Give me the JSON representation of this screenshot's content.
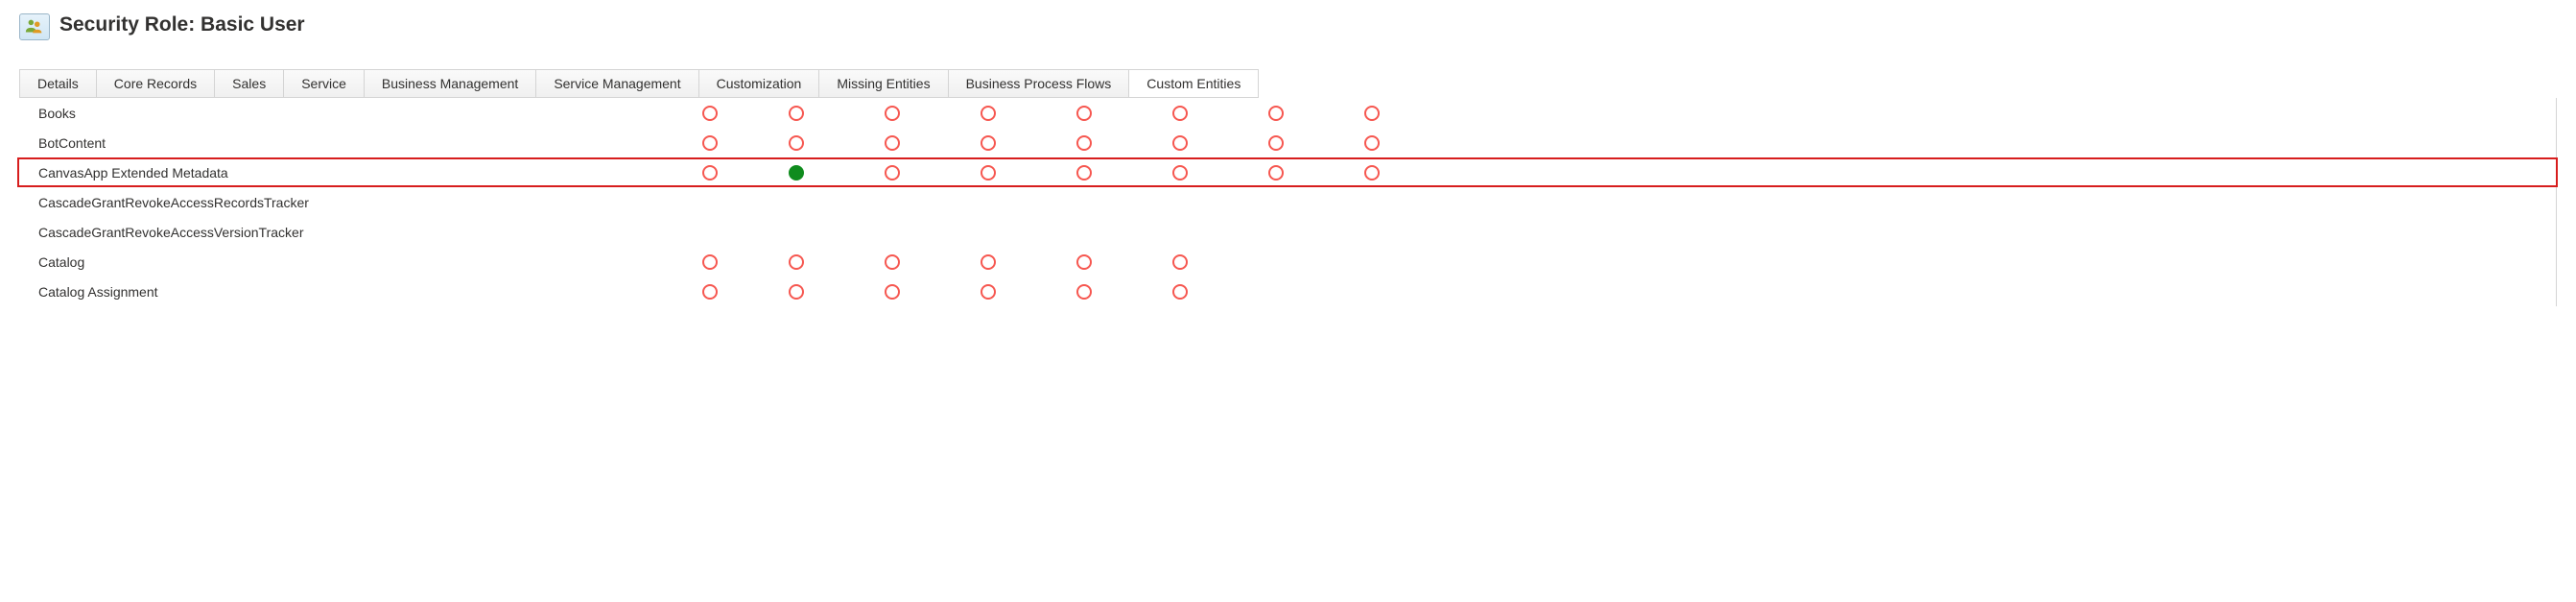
{
  "header": {
    "title": "Security Role: Basic User"
  },
  "tabs": [
    {
      "label": "Details"
    },
    {
      "label": "Core Records"
    },
    {
      "label": "Sales"
    },
    {
      "label": "Service"
    },
    {
      "label": "Business Management"
    },
    {
      "label": "Service Management"
    },
    {
      "label": "Customization"
    },
    {
      "label": "Missing Entities"
    },
    {
      "label": "Business Process Flows"
    },
    {
      "label": "Custom Entities"
    }
  ],
  "rows": [
    {
      "label": "Books",
      "privileges": [
        "none",
        "none",
        "none",
        "none",
        "none",
        "none",
        "none",
        "none"
      ]
    },
    {
      "label": "BotContent",
      "privileges": [
        "none",
        "none",
        "none",
        "none",
        "none",
        "none",
        "none",
        "none"
      ]
    },
    {
      "label": "CanvasApp Extended Metadata",
      "highlighted": true,
      "privileges": [
        "none",
        "org",
        "none",
        "none",
        "none",
        "none",
        "none",
        "none"
      ]
    },
    {
      "label": "CascadeGrantRevokeAccessRecordsTracker",
      "privileges": [
        "",
        "",
        "",
        "",
        "",
        "",
        "",
        ""
      ]
    },
    {
      "label": "CascadeGrantRevokeAccessVersionTracker",
      "privileges": [
        "",
        "",
        "",
        "",
        "",
        "",
        "",
        ""
      ]
    },
    {
      "label": "Catalog",
      "privileges": [
        "none",
        "none",
        "none",
        "none",
        "none",
        "none",
        "",
        ""
      ]
    },
    {
      "label": "Catalog Assignment",
      "privileges": [
        "none",
        "none",
        "none",
        "none",
        "none",
        "none",
        "",
        ""
      ]
    }
  ]
}
